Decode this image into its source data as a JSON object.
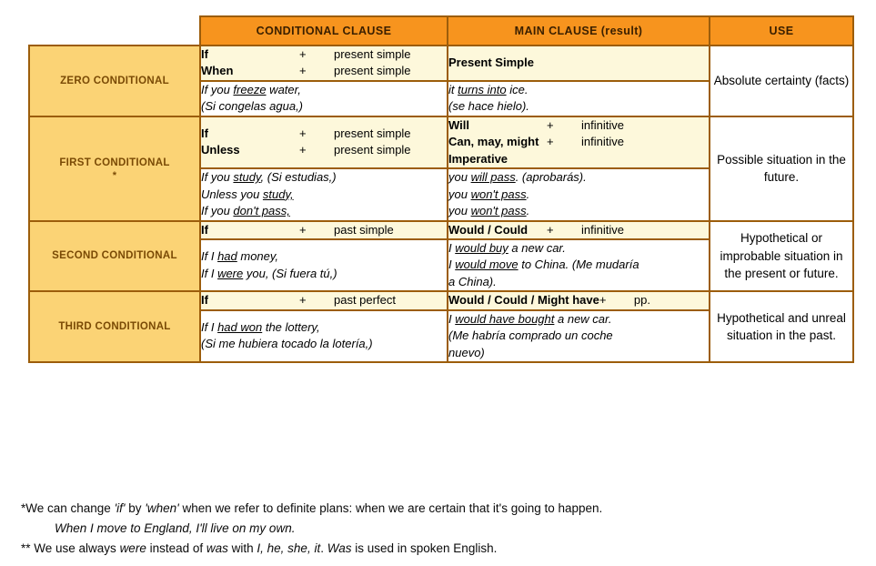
{
  "table": {
    "headers": {
      "type_col": "",
      "conditional_clause": "CONDITIONAL CLAUSE",
      "main_clause": "MAIN CLAUSE (result)",
      "use": "USE"
    },
    "colors": {
      "header_bg": "#F7941E",
      "header_text": "#3B2000",
      "type_bg": "#FBD375",
      "type_text": "#7A4A05",
      "formula_bg": "#FDF8DB",
      "example_bg": "#FFFFFF",
      "border": "#9C5D0B"
    },
    "rows": [
      {
        "type_label": "ZERO CONDITIONAL",
        "type_star": "",
        "conditional_formula": [
          {
            "keyword": "If",
            "plus": "+",
            "tail": "present simple"
          },
          {
            "keyword": "When",
            "plus": "+",
            "tail": "present simple"
          }
        ],
        "main_formula": [
          {
            "keyword": "Present Simple",
            "plus": "",
            "tail": ""
          }
        ],
        "conditional_examples": [
          {
            "pre": "If you ",
            "underline": "freeze",
            "post": " water,"
          },
          {
            "pre": "(Si congelas agua,)",
            "underline": "",
            "post": ""
          }
        ],
        "main_examples": [
          {
            "pre": "it ",
            "underline": "turns into",
            "post": " ice."
          },
          {
            "pre": "(se hace hielo).",
            "underline": "",
            "post": ""
          }
        ],
        "use": "Absolute certainty (facts)"
      },
      {
        "type_label": "FIRST CONDITIONAL",
        "type_star": "*",
        "conditional_formula": [
          {
            "keyword": "If",
            "plus": "+",
            "tail": "present simple"
          },
          {
            "keyword": "Unless",
            "plus": "+",
            "tail": "present simple"
          }
        ],
        "main_formula": [
          {
            "keyword": "Will",
            "plus": "+",
            "tail": "infinitive"
          },
          {
            "keyword": "Can, may, might",
            "plus": "+",
            "tail": "infinitive"
          },
          {
            "keyword": "Imperative",
            "plus": "",
            "tail": ""
          }
        ],
        "conditional_examples": [
          {
            "pre": "If you ",
            "underline": "study",
            "post": ",  (Si estudias,)"
          },
          {
            "pre": "Unless you ",
            "underline": "study,",
            "post": ""
          },
          {
            "pre": "If you ",
            "underline": "don't pass,",
            "post": ""
          }
        ],
        "main_examples": [
          {
            "pre": "you ",
            "underline": "will pass",
            "post": ". (aprobarás)."
          },
          {
            "pre": "you ",
            "underline": "won't pass",
            "post": "."
          },
          {
            "pre": "you ",
            "underline": "won't pass",
            "post": "."
          }
        ],
        "use": "Possible situation in the future."
      },
      {
        "type_label": "SECOND CONDITIONAL",
        "type_star": "",
        "conditional_formula": [
          {
            "keyword": "If",
            "plus": "+",
            "tail": "past simple"
          }
        ],
        "main_formula": [
          {
            "keyword": "Would  /  Could",
            "plus": "+",
            "tail": "infinitive"
          }
        ],
        "conditional_examples": [
          {
            "pre": "If I ",
            "underline": "had",
            "post": " money,"
          },
          {
            "pre": "If I ",
            "underline": "were",
            "post": " you,  (Si fuera tú,)"
          }
        ],
        "main_examples": [
          {
            "pre": "I ",
            "underline": "would buy",
            "post": " a new car."
          },
          {
            "pre": "I ",
            "underline": "would move",
            "post": " to China. (Me mudaría"
          },
          {
            "pre": "a China).",
            "underline": "",
            "post": ""
          }
        ],
        "use": "Hypothetical or improbable situation in the present or future."
      },
      {
        "type_label": "THIRD CONDITIONAL",
        "type_star": "",
        "conditional_formula": [
          {
            "keyword": "If",
            "plus": "+",
            "tail": "past perfect"
          }
        ],
        "main_formula": [
          {
            "keyword": "Would / Could / Might have",
            "plus": "+",
            "tail": "pp."
          }
        ],
        "conditional_examples": [
          {
            "pre": "If I ",
            "underline": "had won",
            "post": " the lottery,"
          },
          {
            "pre": "(Si me hubiera tocado la lotería,)",
            "underline": "",
            "post": ""
          }
        ],
        "main_examples": [
          {
            "pre": "I ",
            "underline": "would have bought",
            "post": " a new car."
          },
          {
            "pre": "(Me habría comprado un coche",
            "underline": "",
            "post": ""
          },
          {
            "pre": "nuevo)",
            "underline": "",
            "post": ""
          }
        ],
        "use": "Hypothetical and unreal situation in the past."
      }
    ]
  },
  "footnotes": {
    "line1_a": "*We can change ",
    "line1_it1": "'if'",
    "line1_b": " by ",
    "line1_it2": "'when'",
    "line1_c": " when we refer to definite plans: when we are certain that it's going to happen.",
    "line2_it": "When I move to England, I'll live on my own.",
    "line3_a": "** We use always ",
    "line3_it1": "were",
    "line3_b": " instead of ",
    "line3_it2": "was",
    "line3_c": " with ",
    "line3_it3": "I, he, she, it",
    "line3_d": ". ",
    "line3_it4": "Was",
    "line3_e": " is used in spoken English."
  }
}
